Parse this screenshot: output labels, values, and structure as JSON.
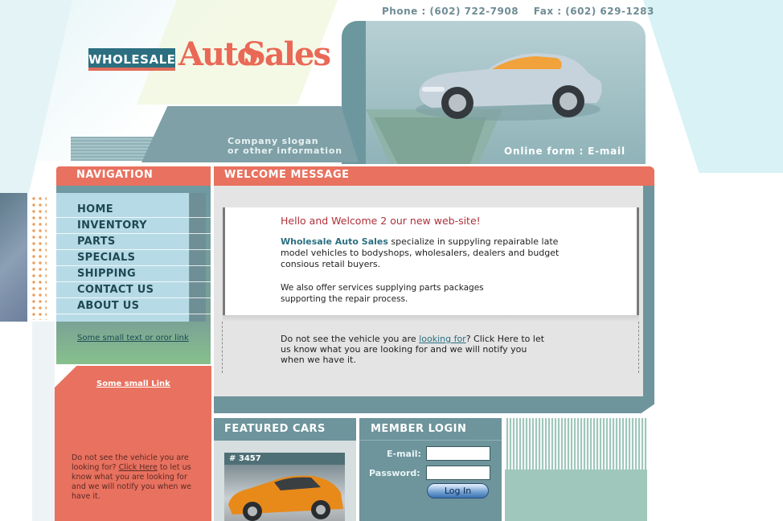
{
  "header": {
    "contact": "Phone : (602) 722-7908    Fax : (602) 629-1283",
    "logo_word1": "WHOLESALE",
    "logo_word2": "Auto",
    "logo_word3": "Sales",
    "slogan_line1": "Company slogan",
    "slogan_line2": "or other information",
    "online_links": "Online form : E-mail"
  },
  "nav": {
    "title": "NAVIGATION",
    "items": [
      {
        "label": "HOME"
      },
      {
        "label": "INVENTORY"
      },
      {
        "label": "PARTS"
      },
      {
        "label": "SPECIALS"
      },
      {
        "label": "SHIPPING"
      },
      {
        "label": "CONTACT US"
      },
      {
        "label": "ABOUT US"
      }
    ],
    "small_link": "Some small text or oror link",
    "red_link": "Some small Link",
    "red_text_before": "Do not see the vehicle you are looking for? ",
    "red_text_link": "Click Here",
    "red_text_after": " to let us know what you are looking for and we will notify you when we have it."
  },
  "welcome": {
    "title": "WELCOME MESSAGE",
    "greeting": "Hello and Welcome 2 our new web-site!",
    "company": "Wholesale Auto Sales",
    "p1_rest": " specialize in suppyling repairable late model vehicles to bodyshops, wholesalers, dealers and budget consious retail buyers.",
    "p2": "We also offer services supplying parts packages supporting the repair process.",
    "p3_before": "Do not see the vehicle you are ",
    "p3_link": "looking for",
    "p3_after": "? Click Here to let us know what you are looking for and we will notify you when we have it."
  },
  "featured": {
    "title": "FEATURED CARS",
    "tag": "# 3457"
  },
  "login": {
    "title": "MEMBER LOGIN",
    "email_label": "E-mail:",
    "password_label": "Password:",
    "button": "Log In"
  },
  "colors": {
    "accent_red": "#e8715f",
    "teal": "#6e949c",
    "dark_teal": "#2b6f80"
  }
}
